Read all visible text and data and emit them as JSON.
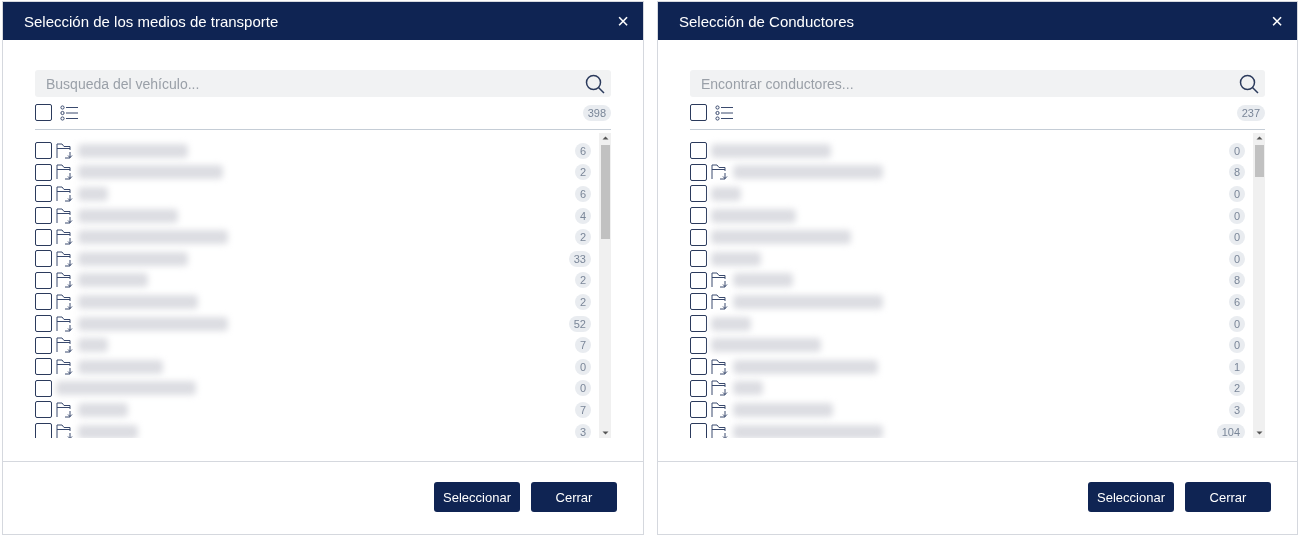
{
  "dialogs": [
    {
      "title": "Selección de los medios de transporte",
      "close": "×",
      "search": {
        "placeholder": "Busqueda del vehículo..."
      },
      "select_all": {
        "checked": false
      },
      "total": "398",
      "rows": [
        {
          "kind": "group",
          "checked": false,
          "count": "6"
        },
        {
          "kind": "group",
          "checked": false,
          "count": "2"
        },
        {
          "kind": "group",
          "checked": false,
          "count": "6"
        },
        {
          "kind": "group",
          "checked": false,
          "count": "4"
        },
        {
          "kind": "group",
          "checked": false,
          "count": "2"
        },
        {
          "kind": "group",
          "checked": false,
          "count": "33"
        },
        {
          "kind": "group",
          "checked": false,
          "count": "2"
        },
        {
          "kind": "group",
          "checked": false,
          "count": "2"
        },
        {
          "kind": "group",
          "checked": false,
          "count": "52"
        },
        {
          "kind": "group",
          "checked": false,
          "count": "7"
        },
        {
          "kind": "group",
          "checked": false,
          "count": "0"
        },
        {
          "kind": "item",
          "checked": false,
          "count": "0"
        },
        {
          "kind": "group",
          "checked": false,
          "count": "7"
        },
        {
          "kind": "group",
          "checked": false,
          "count": "3"
        }
      ],
      "buttons": [
        "Seleccionar",
        "Cerrar"
      ]
    },
    {
      "title": "Selección de Conductores",
      "close": "×",
      "search": {
        "placeholder": "Encontrar conductores..."
      },
      "select_all": {
        "checked": false
      },
      "total": "237",
      "rows": [
        {
          "kind": "item",
          "checked": false,
          "count": "0"
        },
        {
          "kind": "group",
          "checked": false,
          "count": "8"
        },
        {
          "kind": "item",
          "checked": false,
          "count": "0"
        },
        {
          "kind": "item",
          "checked": false,
          "count": "0"
        },
        {
          "kind": "item",
          "checked": false,
          "count": "0"
        },
        {
          "kind": "item",
          "checked": false,
          "count": "0"
        },
        {
          "kind": "group",
          "checked": false,
          "count": "8"
        },
        {
          "kind": "group",
          "checked": false,
          "count": "6"
        },
        {
          "kind": "item",
          "checked": false,
          "count": "0"
        },
        {
          "kind": "item",
          "checked": false,
          "count": "0"
        },
        {
          "kind": "group",
          "checked": false,
          "count": "1"
        },
        {
          "kind": "group",
          "checked": false,
          "count": "2"
        },
        {
          "kind": "group",
          "checked": false,
          "count": "3"
        },
        {
          "kind": "group",
          "checked": false,
          "count": "104"
        }
      ],
      "buttons": [
        "Seleccionar",
        "Cerrar"
      ]
    }
  ]
}
